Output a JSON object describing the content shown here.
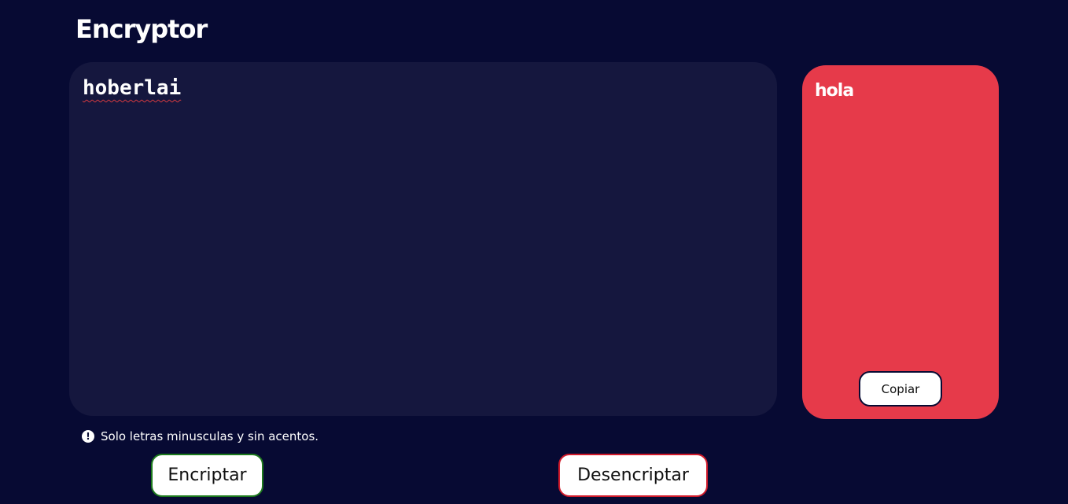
{
  "app": {
    "title": "Encryptor"
  },
  "input": {
    "value": "hoberlai"
  },
  "output": {
    "value": "hola",
    "copy_label": "Copiar"
  },
  "hint": {
    "icon": "info-icon",
    "text": "Solo letras minusculas y sin acentos."
  },
  "actions": {
    "encrypt_label": "Encriptar",
    "decrypt_label": "Desencriptar"
  },
  "colors": {
    "background": "#070a33",
    "input_panel": "#15173e",
    "output_panel": "#e63a4a",
    "encrypt_border": "#1d7a1d",
    "decrypt_border": "#d11a2a"
  }
}
